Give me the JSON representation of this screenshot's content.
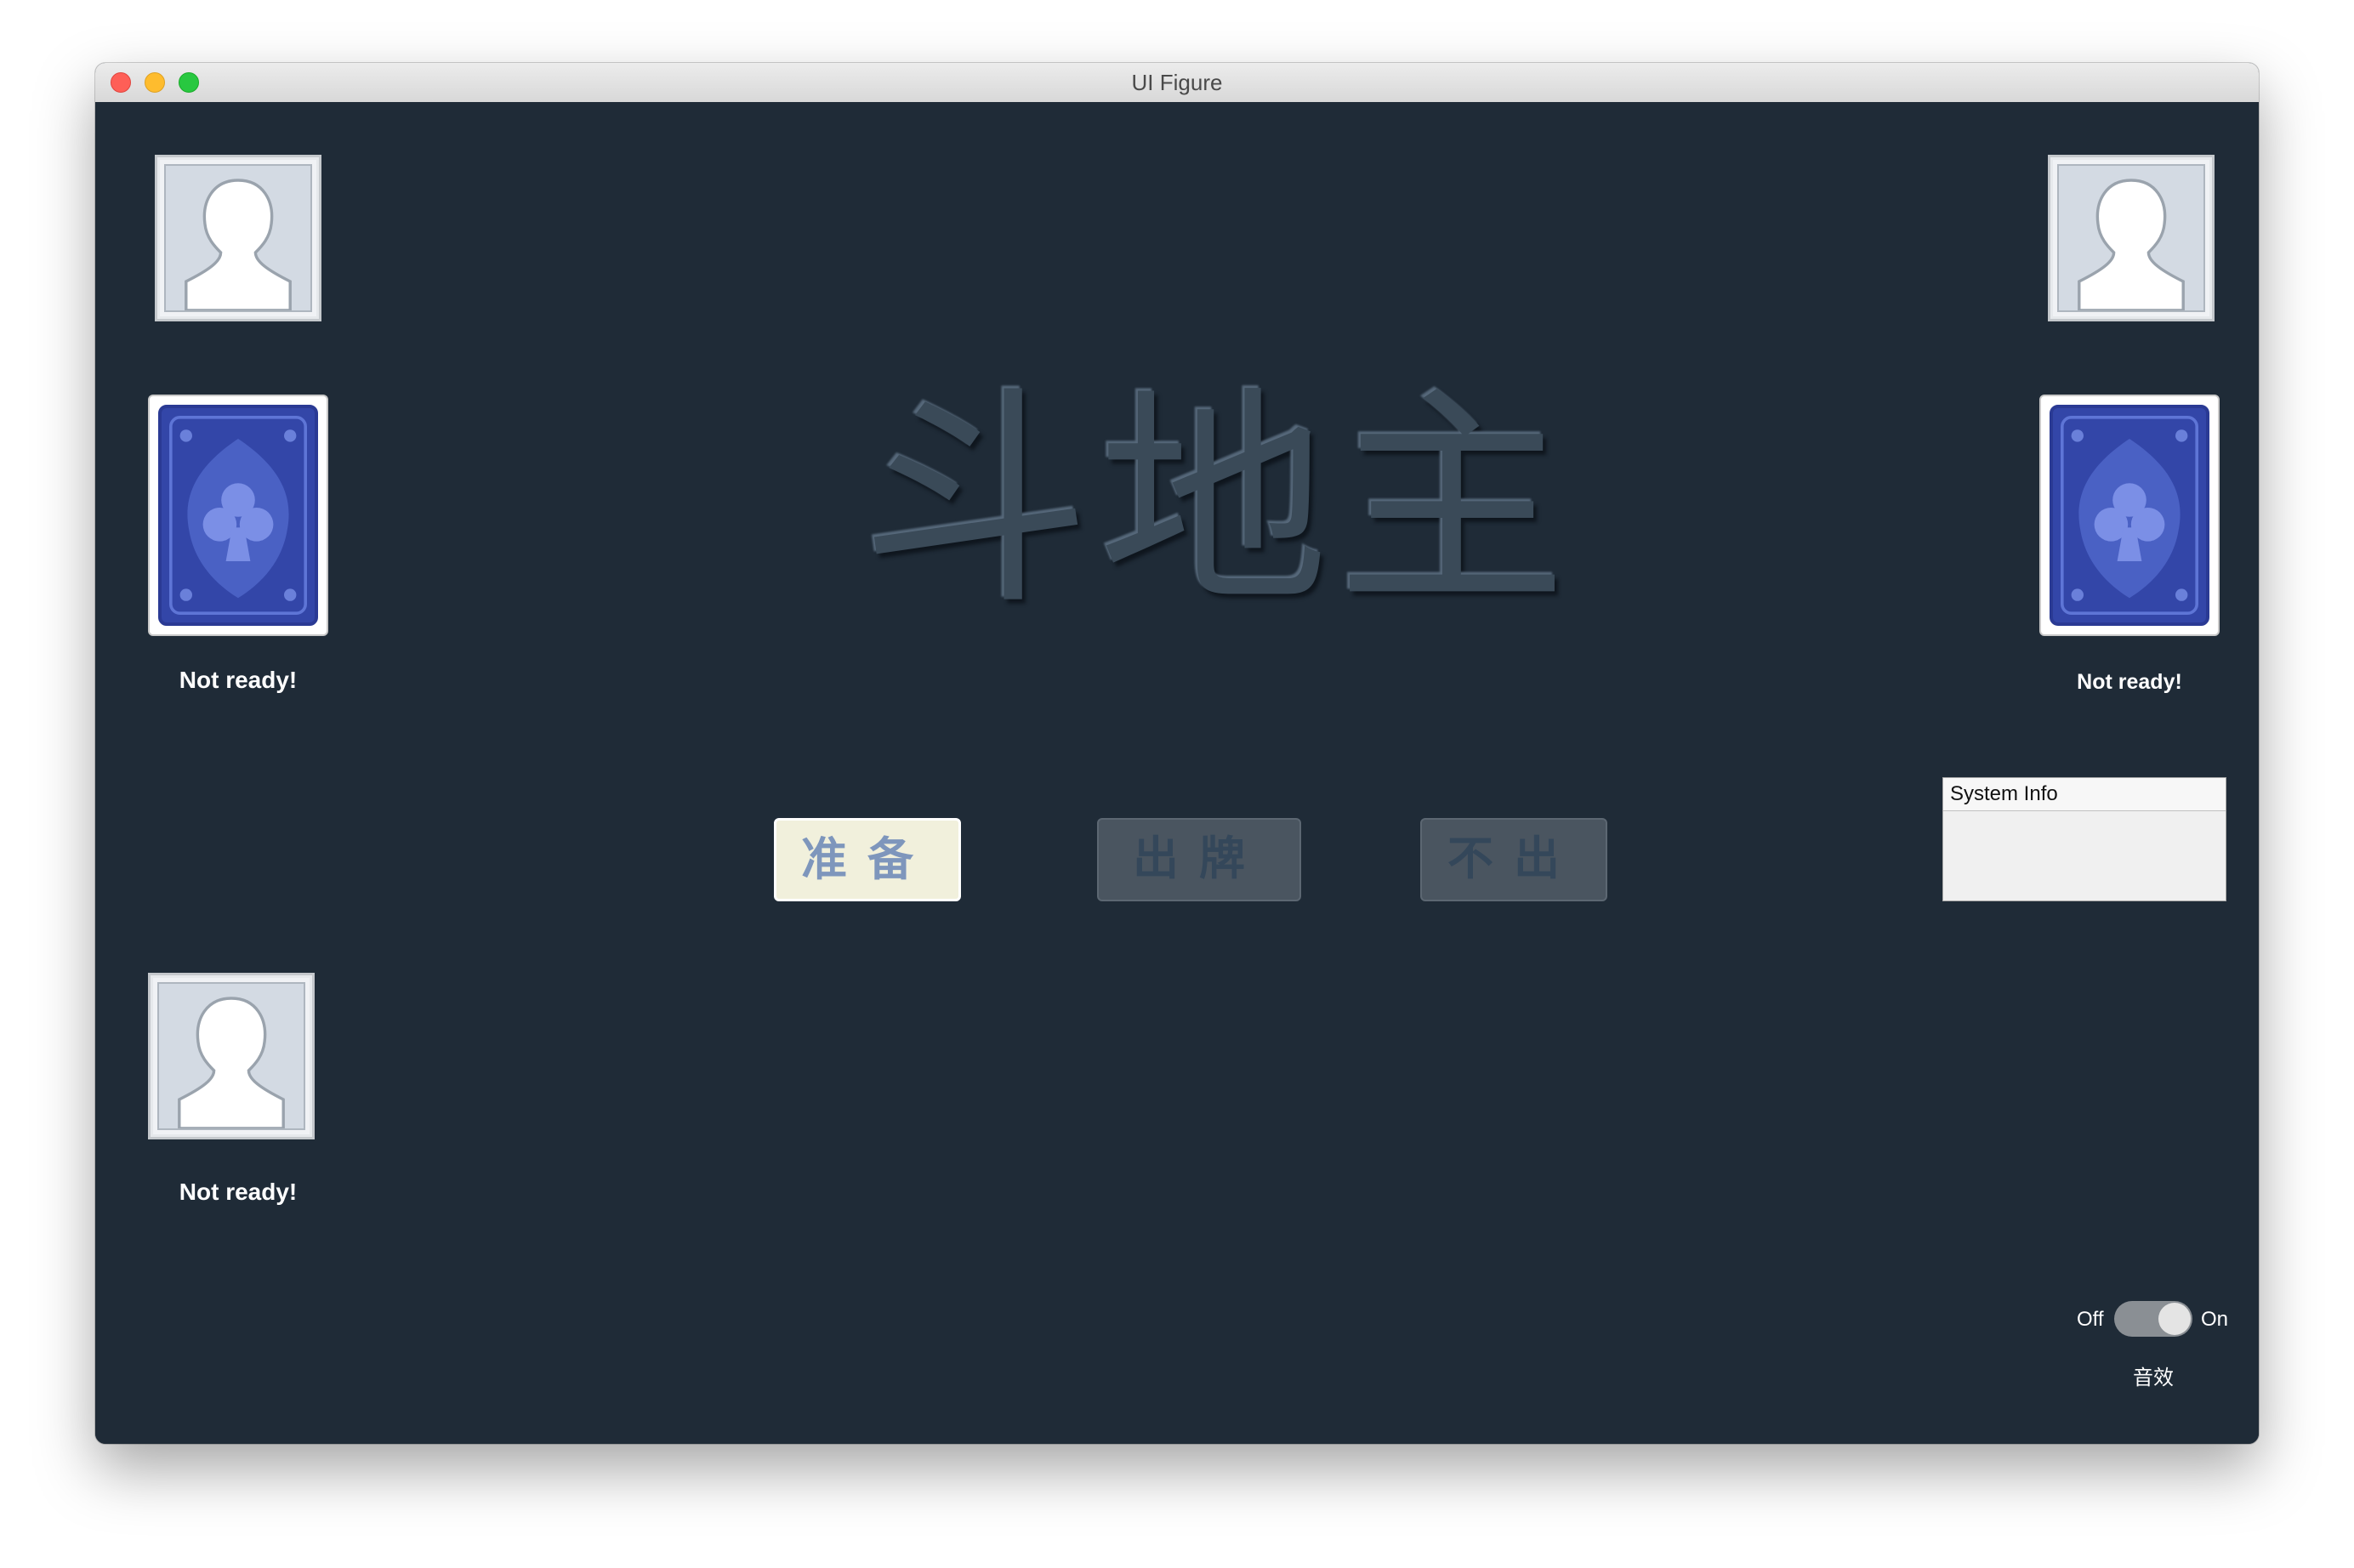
{
  "window": {
    "title": "UI Figure"
  },
  "game": {
    "logo": "斗地主"
  },
  "players": {
    "top_left": {
      "status": "Not ready!"
    },
    "top_right": {
      "status": "Not ready!"
    },
    "bottom_left": {
      "status": "Not ready!"
    }
  },
  "actions": {
    "ready_label": "准备",
    "play_label": "出牌",
    "pass_label": "不出"
  },
  "system_info": {
    "title": "System Info"
  },
  "sound": {
    "off_label": "Off",
    "on_label": "On",
    "label": "音效",
    "state": "On"
  },
  "colors": {
    "background": "#1f2b37",
    "card_back": "#3346a8",
    "ready_button": "#f1f0dc",
    "disabled_button": "#4a5560"
  },
  "icons": {
    "avatar": "person-silhouette-icon",
    "card_back": "club-card-back-icon"
  }
}
